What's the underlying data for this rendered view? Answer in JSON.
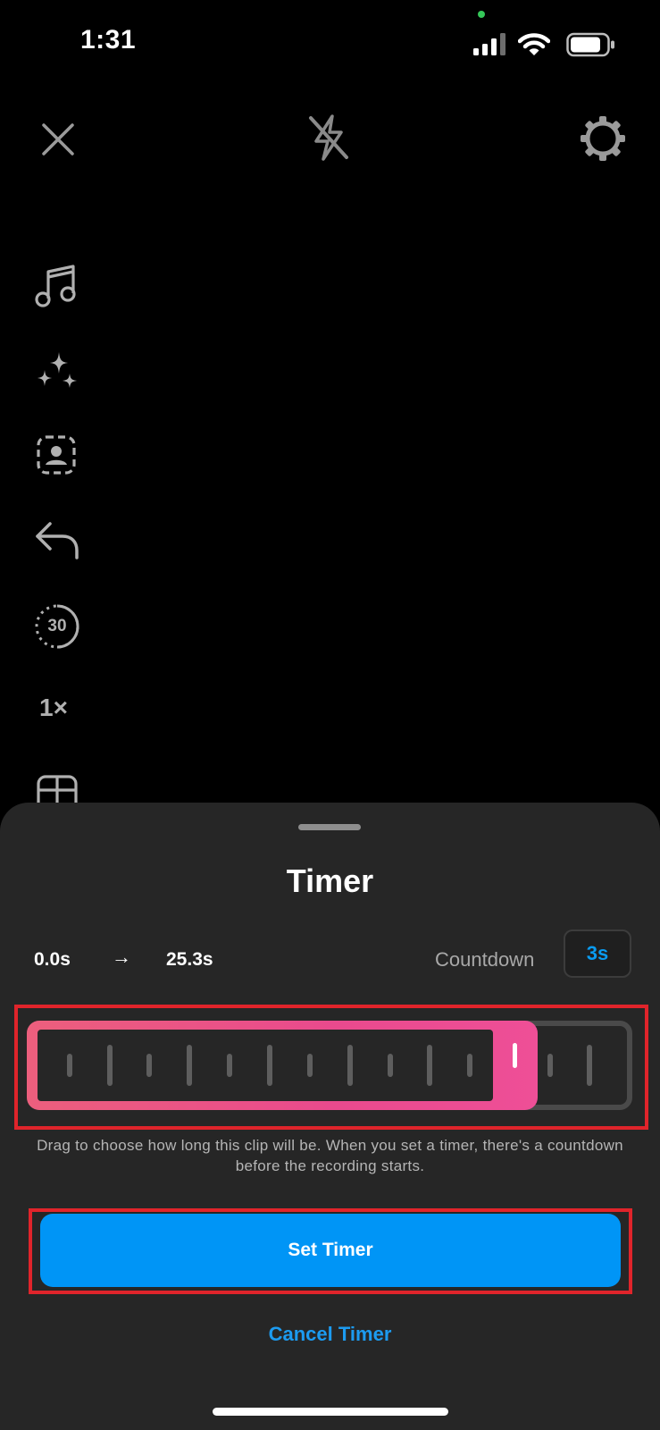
{
  "status_bar": {
    "time": "1:31"
  },
  "top_bar": {
    "icons": [
      "close-icon",
      "flash-off-icon",
      "settings-gear-icon"
    ]
  },
  "side_tools": {
    "icons": [
      "music-note-icon",
      "sparkles-effects-icon",
      "green-screen-icon",
      "undo-arrow-icon",
      "timer-length-icon",
      "speed-icon",
      "layout-icon"
    ],
    "length_label": "30",
    "speed_label": "1×"
  },
  "timer_sheet": {
    "title": "Timer",
    "range_start": "0.0s",
    "range_arrow": "→",
    "range_end": "25.3s",
    "countdown_label": "Countdown",
    "countdown_value": "3s",
    "selected_fraction": 0.843,
    "helper_text": "Drag to choose how long this clip will be. When you set a timer, there's a countdown before the recording starts.",
    "set_button_label": "Set Timer",
    "cancel_label": "Cancel Timer"
  },
  "colors": {
    "accent_blue": "#0095f6",
    "selection_pink": "#e94a8d",
    "annotation_red": "#e0242b",
    "sheet_background": "#262626"
  }
}
